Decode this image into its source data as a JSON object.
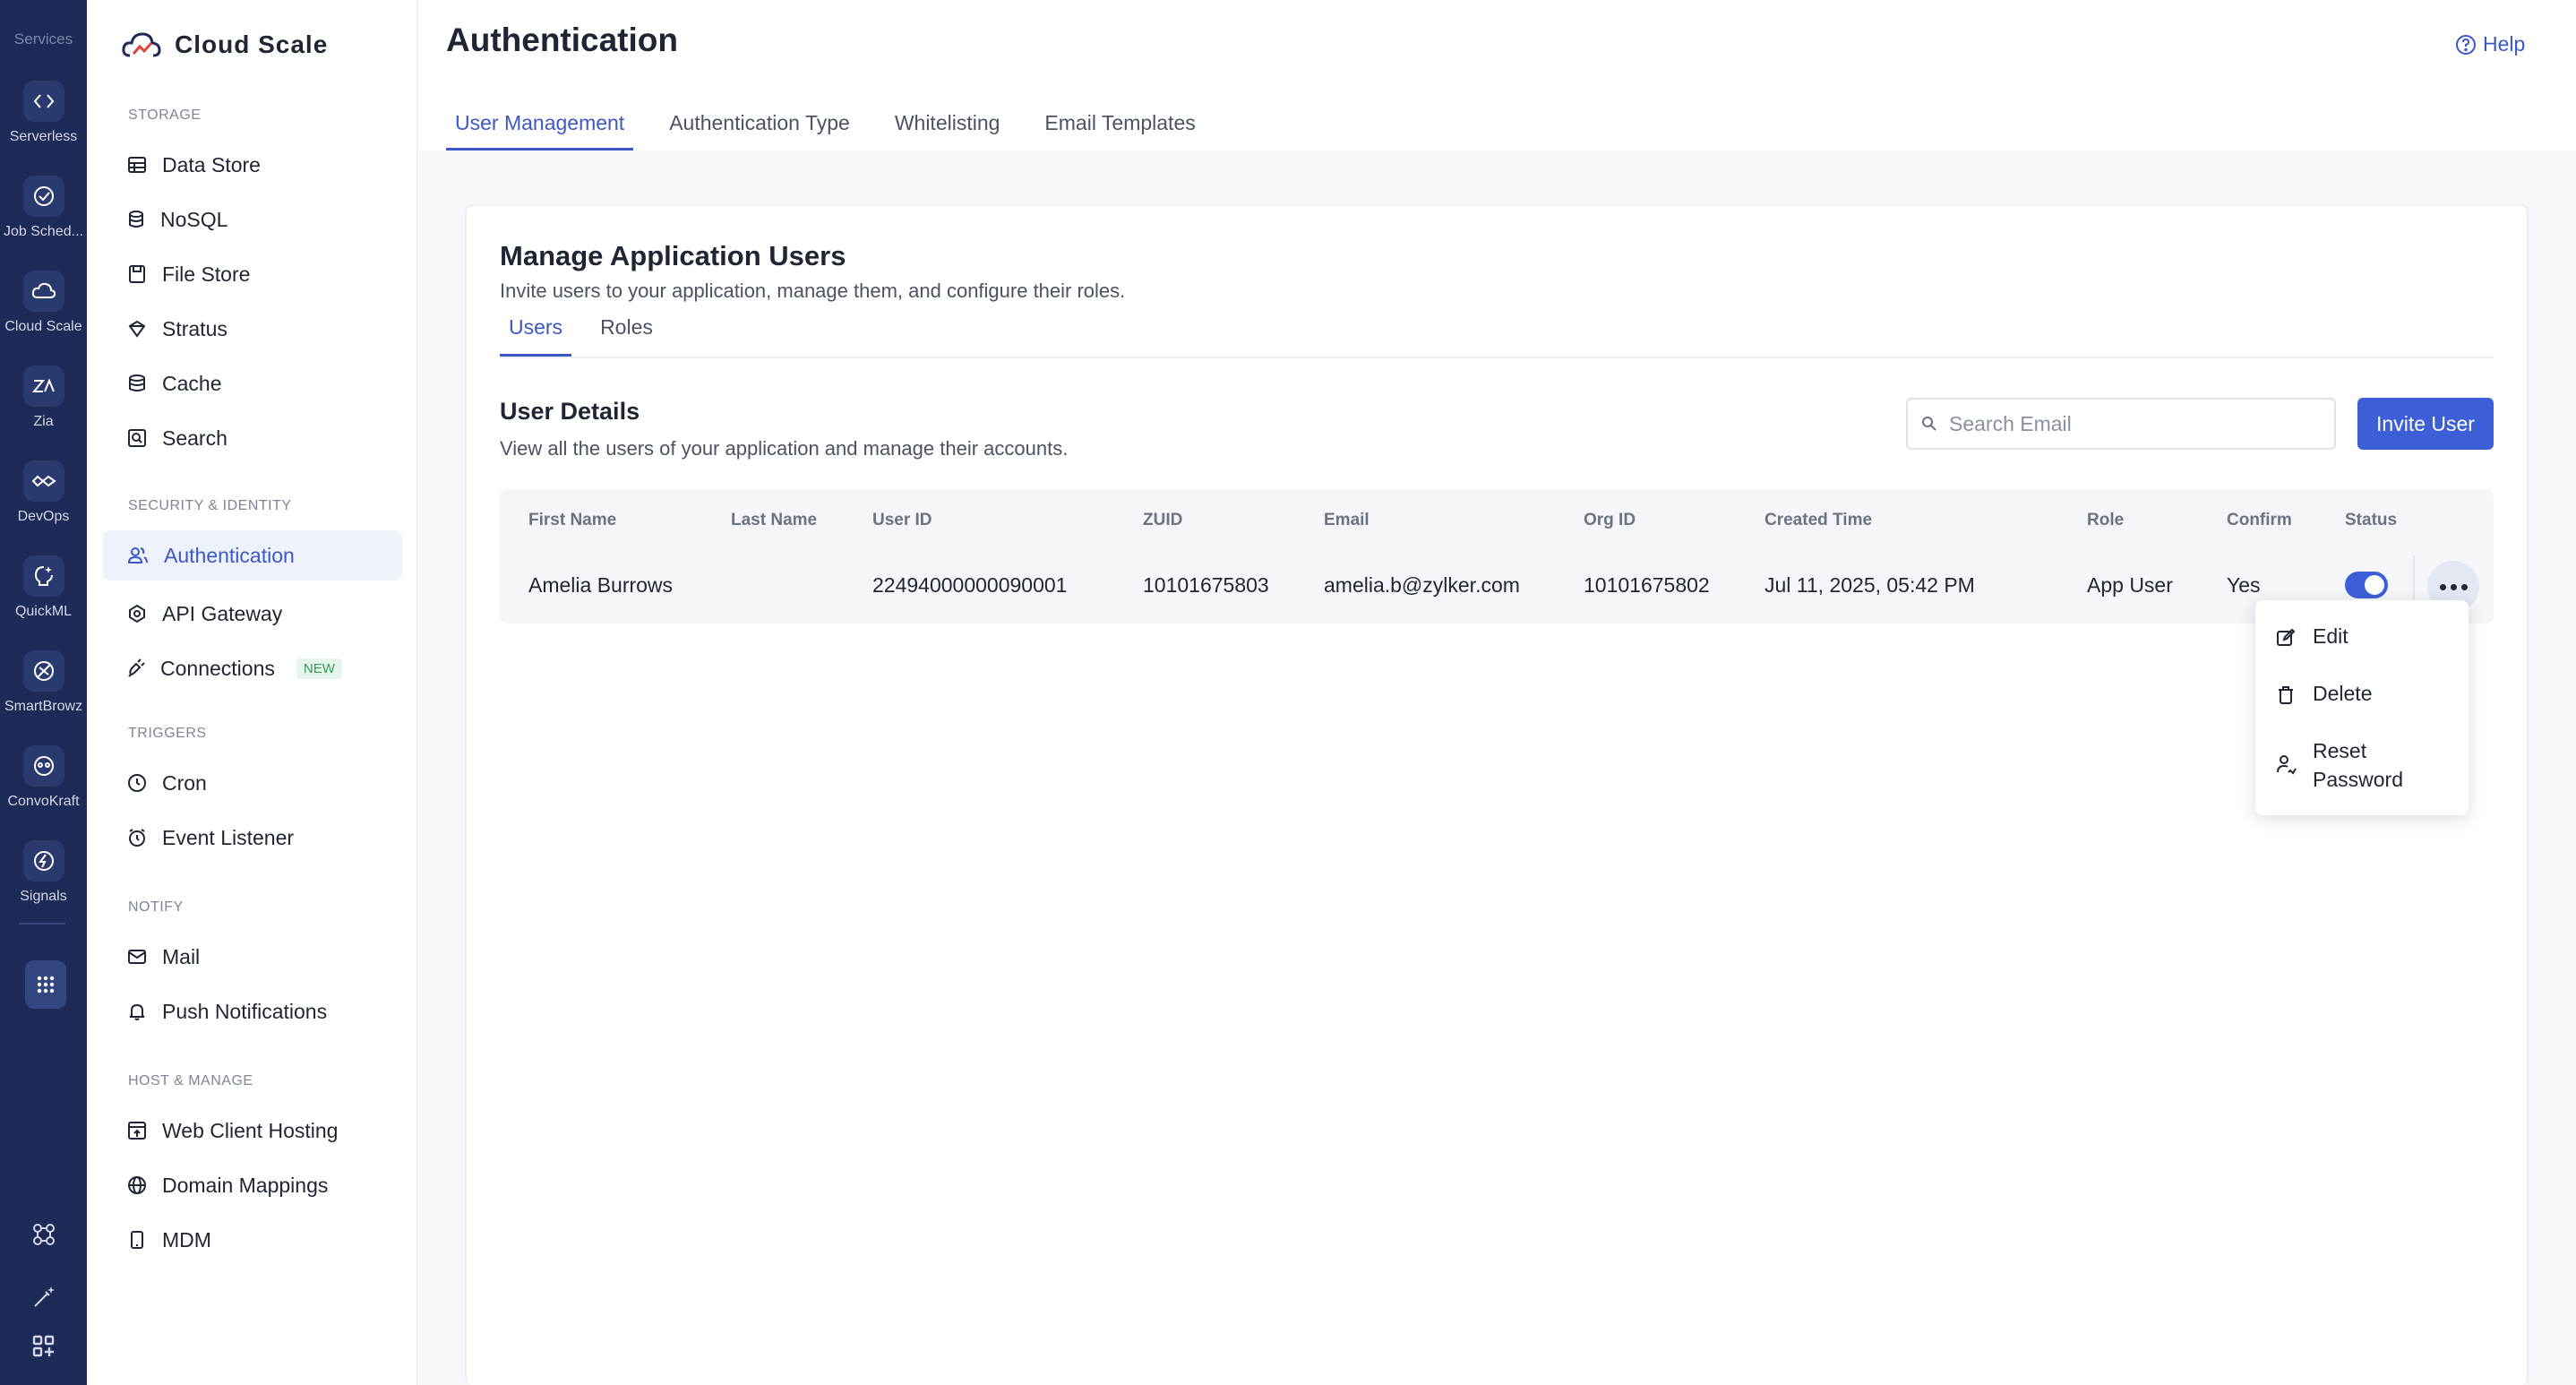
{
  "rail": {
    "heading": "Services",
    "items": [
      {
        "label": "Serverless",
        "icon": "code-icon"
      },
      {
        "label": "Job Sched...",
        "icon": "check-circle-icon"
      },
      {
        "label": "Cloud Scale",
        "icon": "cloud-icon"
      },
      {
        "label": "Zia",
        "icon": "zia-icon"
      },
      {
        "label": "DevOps",
        "icon": "infinity-icon"
      },
      {
        "label": "QuickML",
        "icon": "brain-icon"
      },
      {
        "label": "SmartBrowz",
        "icon": "browser-icon"
      },
      {
        "label": "ConvoKraft",
        "icon": "chatbot-icon"
      },
      {
        "label": "Signals",
        "icon": "signal-icon"
      }
    ]
  },
  "brand": {
    "name": "Cloud Scale"
  },
  "sidebar": {
    "storage": {
      "title": "STORAGE",
      "items": [
        {
          "label": "Data Store",
          "icon": "table-icon"
        },
        {
          "label": "NoSQL",
          "icon": "database-icon"
        },
        {
          "label": "File Store",
          "icon": "folder-icon"
        },
        {
          "label": "Stratus",
          "icon": "bucket-icon"
        },
        {
          "label": "Cache",
          "icon": "cache-icon"
        },
        {
          "label": "Search",
          "icon": "search-box-icon"
        }
      ]
    },
    "security": {
      "title": "SECURITY & IDENTITY",
      "items": [
        {
          "label": "Authentication",
          "icon": "users-icon"
        },
        {
          "label": "API Gateway",
          "icon": "gateway-icon"
        },
        {
          "label": "Connections",
          "icon": "plug-icon",
          "badge": "NEW"
        }
      ]
    },
    "triggers": {
      "title": "TRIGGERS",
      "items": [
        {
          "label": "Cron",
          "icon": "clock-icon"
        },
        {
          "label": "Event Listener",
          "icon": "alarm-icon"
        }
      ]
    },
    "notify": {
      "title": "NOTIFY",
      "items": [
        {
          "label": "Mail",
          "icon": "mail-icon"
        },
        {
          "label": "Push Notifications",
          "icon": "bell-icon"
        }
      ]
    },
    "host": {
      "title": "HOST & MANAGE",
      "items": [
        {
          "label": "Web Client Hosting",
          "icon": "upload-window-icon"
        },
        {
          "label": "Domain Mappings",
          "icon": "globe-icon"
        },
        {
          "label": "MDM",
          "icon": "mobile-icon"
        }
      ]
    }
  },
  "header": {
    "title": "Authentication",
    "help": "Help",
    "tabs": [
      "User Management",
      "Authentication Type",
      "Whitelisting",
      "Email Templates"
    ]
  },
  "card": {
    "title": "Manage Application Users",
    "subtitle": "Invite users to your application, manage them, and configure their roles.",
    "subtabs": [
      "Users",
      "Roles"
    ],
    "section_title": "User Details",
    "section_subtitle": "View all the users of your application and manage their accounts.",
    "search_placeholder": "Search Email",
    "invite_label": "Invite User"
  },
  "table": {
    "columns": [
      "First Name",
      "Last Name",
      "User ID",
      "ZUID",
      "Email",
      "Org ID",
      "Created Time",
      "Role",
      "Confirm",
      "Status"
    ],
    "rows": [
      {
        "first_name": "Amelia Burrows",
        "last_name": "",
        "user_id": "22494000000090001",
        "zuid": "10101675803",
        "email": "amelia.b@zylker.com",
        "org_id": "10101675802",
        "created": "Jul 11, 2025, 05:42 PM",
        "role": "App User",
        "confirm": "Yes",
        "status_on": true
      }
    ]
  },
  "menu": {
    "items": [
      {
        "label": "Edit",
        "icon": "edit-icon"
      },
      {
        "label": "Delete",
        "icon": "trash-icon"
      },
      {
        "label": "Reset\nPassword",
        "icon": "reset-password-icon"
      }
    ]
  },
  "colors": {
    "rail_bg": "#1e2a57",
    "accent": "#3c58c6",
    "button": "#3c5fd8"
  }
}
